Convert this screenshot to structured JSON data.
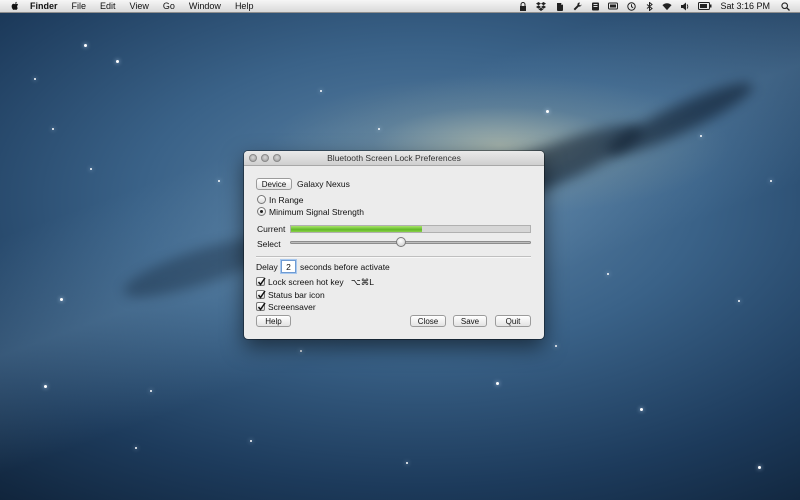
{
  "menubar": {
    "app_name": "Finder",
    "items": [
      "File",
      "Edit",
      "View",
      "Go",
      "Window",
      "Help"
    ],
    "status_icons": [
      "lock-icon",
      "dropbox-icon",
      "evernote-icon",
      "wrench-icon",
      "script-icon",
      "display-icon",
      "battery-box-icon",
      "time-machine-icon",
      "bluetooth-icon",
      "wifi-icon",
      "volume-icon",
      "battery-icon"
    ],
    "clock": "Sat 3:16 PM"
  },
  "window": {
    "title": "Bluetooth Screen Lock Preferences",
    "device_button": "Device",
    "device_name": "Galaxy Nexus",
    "mode": {
      "options": [
        "In Range",
        "Minimum Signal Strength"
      ],
      "selected": "Minimum Signal Strength"
    },
    "current_label": "Current",
    "current_level": 0.55,
    "select_label": "Select",
    "select_level": 0.46,
    "delay_label": "Delay",
    "delay_value": "2",
    "delay_suffix": "seconds before activate",
    "options": [
      {
        "label": "Lock screen hot key",
        "checked": true,
        "shortcut": "⌥⌘L"
      },
      {
        "label": "Status bar icon",
        "checked": true
      },
      {
        "label": "Screensaver",
        "checked": true
      }
    ],
    "buttons": {
      "help": "Help",
      "close": "Close",
      "save": "Save",
      "quit": "Quit"
    }
  }
}
